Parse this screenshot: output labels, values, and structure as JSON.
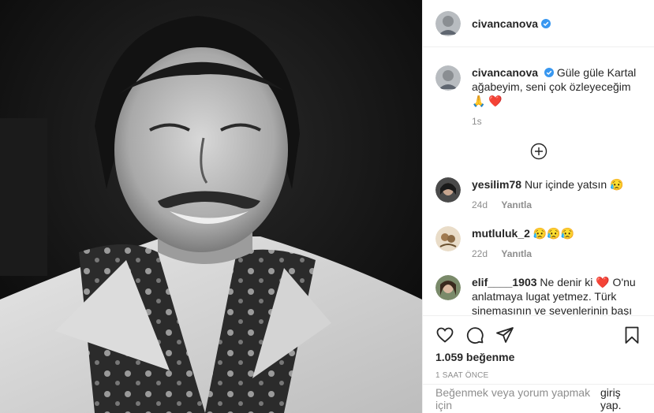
{
  "post": {
    "author": "civancanova",
    "caption": "Güle güle Kartal ağabeyim, seni çok özleyeceğim 🙏 ❤️",
    "caption_age": "1s"
  },
  "comments": [
    {
      "user": "yesilim78",
      "text": "Nur içinde yatsın 😥",
      "age": "24d",
      "reply": "Yanıtla"
    },
    {
      "user": "mutluluk_2",
      "text": "😥😥😥",
      "age": "22d",
      "reply": "Yanıtla"
    },
    {
      "user": "elif____1903",
      "text": "Ne denir ki ❤️ O'nu anlatmaya lugat yetmez. Türk sinemasının ve sevenlerinin başı",
      "age": "",
      "reply": ""
    }
  ],
  "footer": {
    "likes": "1.059 beğenme",
    "time": "1 SAAT ÖNCE",
    "login_prefix": "Beğenmek veya yorum yapmak için",
    "login_link": "giriş yap."
  },
  "icons": {
    "like": "heart-icon",
    "comment": "comment-icon",
    "share": "share-icon",
    "save": "bookmark-icon",
    "load_more": "plus-circle-icon",
    "verified": "verified-badge-icon"
  },
  "colors": {
    "verified": "#3897f0",
    "heart_red": "#ed4956",
    "text": "#262626",
    "muted": "#8e8e8e"
  }
}
